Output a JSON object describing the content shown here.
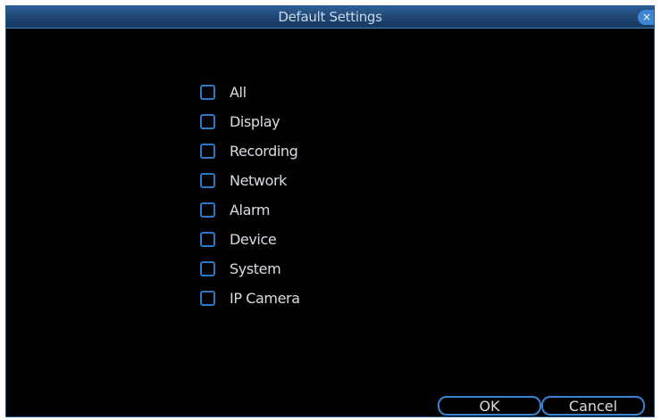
{
  "dialog": {
    "title": "Default Settings",
    "close_symbol": "×"
  },
  "options": [
    {
      "label": "All",
      "checked": false
    },
    {
      "label": "Display",
      "checked": false
    },
    {
      "label": "Recording",
      "checked": false
    },
    {
      "label": "Network",
      "checked": false
    },
    {
      "label": "Alarm",
      "checked": false
    },
    {
      "label": "Device",
      "checked": false
    },
    {
      "label": "System",
      "checked": false
    },
    {
      "label": "IP Camera",
      "checked": false
    }
  ],
  "buttons": {
    "ok_label": "OK",
    "cancel_label": "Cancel"
  },
  "colors": {
    "accent": "#2e78c6",
    "titlebar": "#1d4470",
    "background": "#000000",
    "text": "#d8dde3"
  },
  "icons": {
    "close": "close-icon",
    "checkbox": "checkbox-unchecked-icon"
  }
}
